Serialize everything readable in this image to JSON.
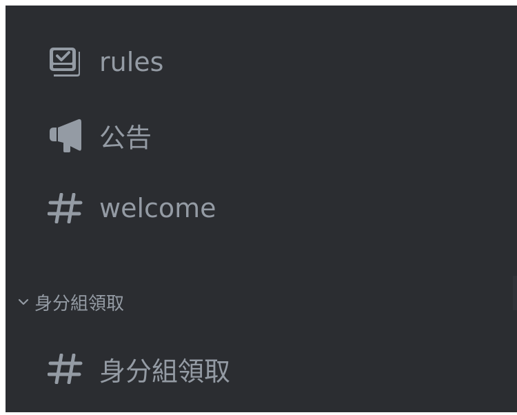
{
  "channels": [
    {
      "name": "rules",
      "icon": "rules-icon"
    },
    {
      "name": "公告",
      "icon": "megaphone-icon"
    },
    {
      "name": "welcome",
      "icon": "hash-icon"
    }
  ],
  "category": {
    "label": "身分組領取",
    "icon": "chevron-down-icon",
    "channels": [
      {
        "name": "身分組領取",
        "icon": "hash-icon"
      }
    ]
  },
  "colors": {
    "background": "#2b2d31",
    "text": "#949ba4"
  }
}
